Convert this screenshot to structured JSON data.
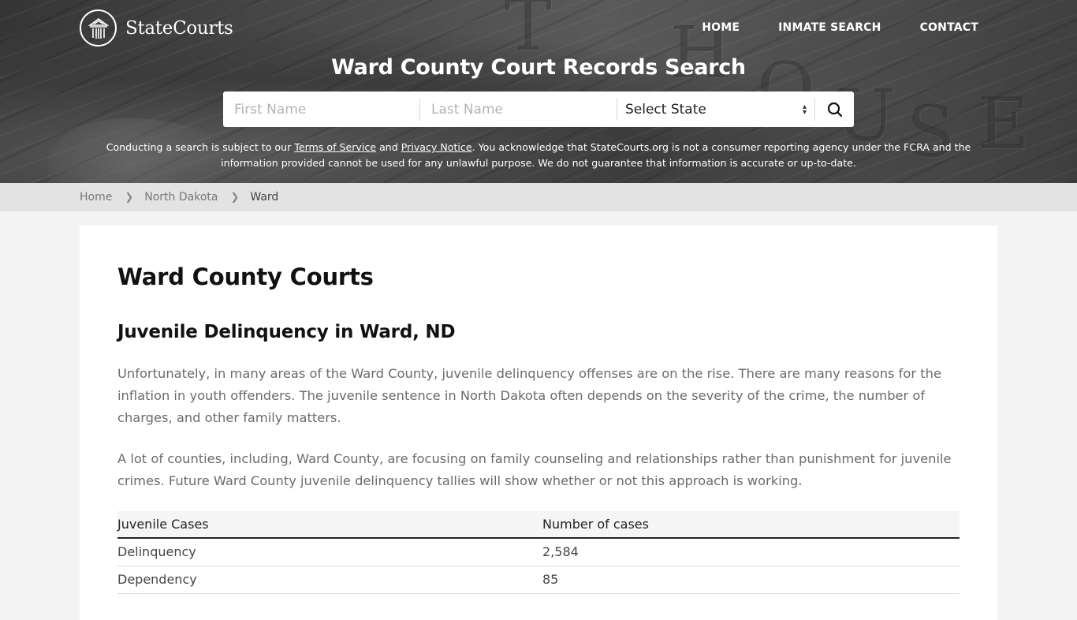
{
  "header": {
    "logo_text": "StateCourts",
    "nav": [
      {
        "label": "HOME"
      },
      {
        "label": "INMATE SEARCH"
      },
      {
        "label": "CONTACT"
      }
    ],
    "title": "Ward County Court Records Search"
  },
  "search": {
    "first_name_placeholder": "First Name",
    "last_name_placeholder": "Last Name",
    "state_select_value": "Select State",
    "search_icon": "search-icon"
  },
  "disclaimer": {
    "part1": "Conducting a search is subject to our ",
    "terms_link": "Terms of Service",
    "part2": " and ",
    "privacy_link": "Privacy Notice",
    "part3": ". You acknowledge that StateCourts.org is not a consumer reporting agency under the FCRA and the information provided cannot be used for any unlawful purpose. We do not guarantee that information is accurate or up-to-date."
  },
  "breadcrumb": {
    "items": [
      {
        "label": "Home"
      },
      {
        "label": "North Dakota"
      },
      {
        "label": "Ward"
      }
    ],
    "separator_icon": "chevron-right-icon"
  },
  "main": {
    "title": "Ward County Courts",
    "section_title": "Juvenile Delinquency in Ward, ND",
    "paragraphs": [
      "Unfortunately, in many areas of the Ward County, juvenile delinquency offenses are on the rise. There are many reasons for the inflation in youth offenders. The juvenile sentence in North Dakota often depends on the severity of the crime, the number of charges, and other family matters.",
      "A lot of counties, including, Ward County, are focusing on family counseling and relationships rather than punishment for juvenile crimes. Future Ward County juvenile delinquency tallies will show whether or not this approach is working."
    ],
    "table": {
      "headers": [
        "Juvenile Cases",
        "Number of cases"
      ],
      "rows": [
        [
          "Delinquency",
          "2,584"
        ],
        [
          "Dependency",
          "85"
        ]
      ]
    }
  }
}
